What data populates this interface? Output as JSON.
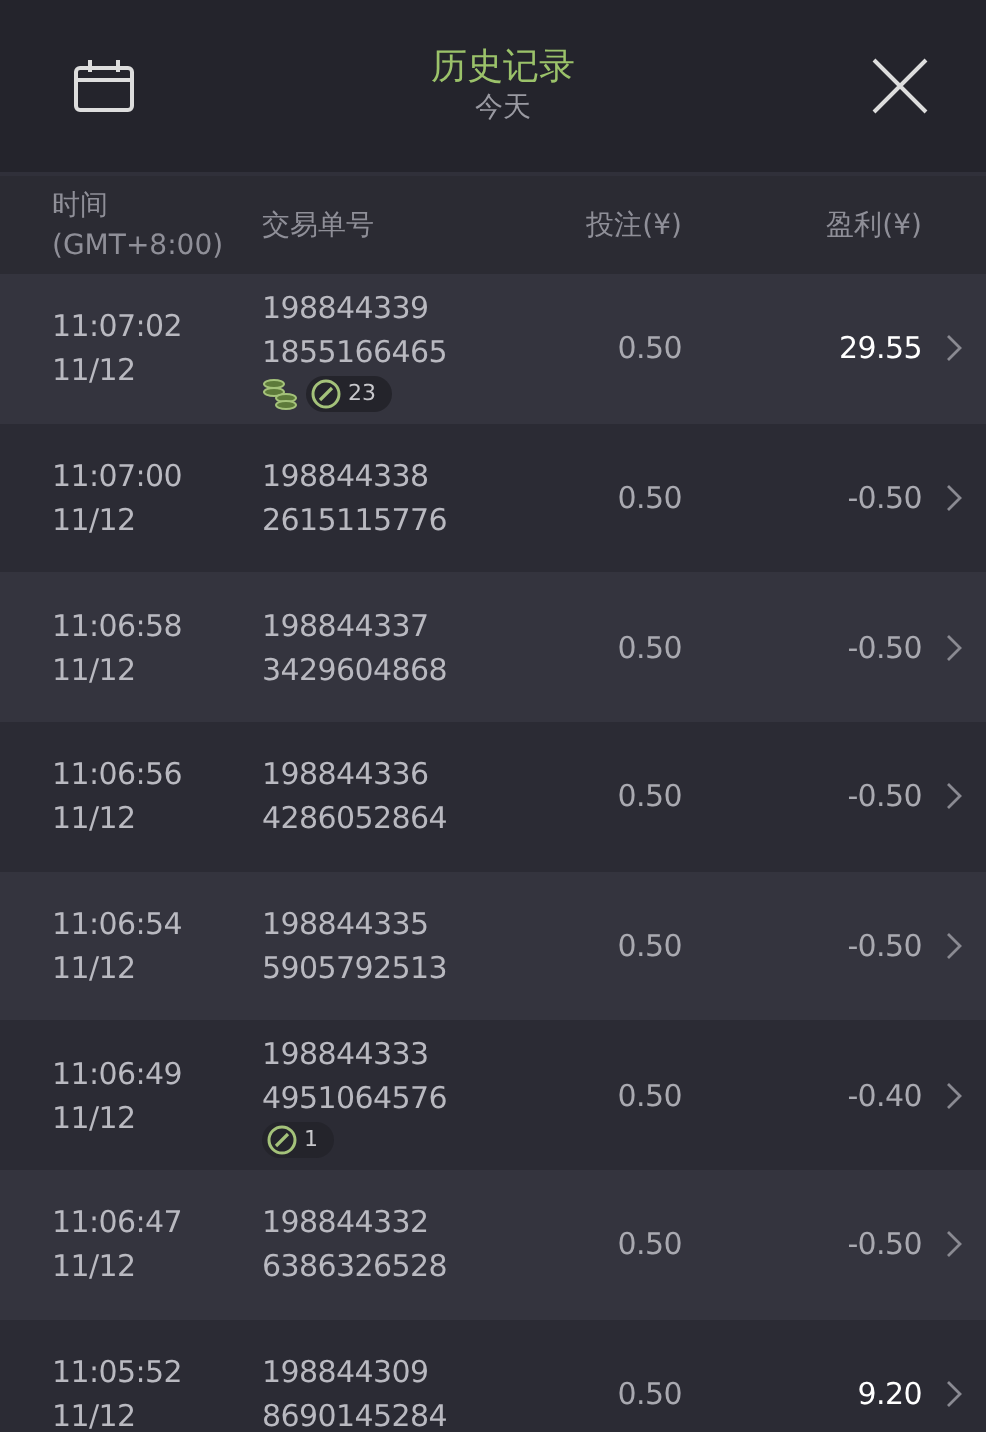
{
  "header": {
    "title": "历史记录",
    "subtitle": "今天"
  },
  "columns": [
    {
      "label": "时间",
      "sublabel": "(GMT+8:00)"
    },
    {
      "label": "交易单号"
    },
    {
      "label": "投注(¥)"
    },
    {
      "label": "盈利(¥)"
    }
  ],
  "rows": [
    {
      "time": "11:07:02",
      "date": "11/12",
      "id": "198844339",
      "ref": "1855166465",
      "coins": true,
      "badge": "23",
      "bet": "0.50",
      "profit": "29.55",
      "won": true
    },
    {
      "time": "11:07:00",
      "date": "11/12",
      "id": "198844338",
      "ref": "2615115776",
      "coins": false,
      "bet": "0.50",
      "profit": "-0.50",
      "won": false
    },
    {
      "time": "11:06:58",
      "date": "11/12",
      "id": "198844337",
      "ref": "3429604868",
      "coins": false,
      "bet": "0.50",
      "profit": "-0.50",
      "won": false
    },
    {
      "time": "11:06:56",
      "date": "11/12",
      "id": "198844336",
      "ref": "4286052864",
      "coins": false,
      "bet": "0.50",
      "profit": "-0.50",
      "won": false
    },
    {
      "time": "11:06:54",
      "date": "11/12",
      "id": "198844335",
      "ref": "5905792513",
      "coins": false,
      "bet": "0.50",
      "profit": "-0.50",
      "won": false
    },
    {
      "time": "11:06:49",
      "date": "11/12",
      "id": "198844333",
      "ref": "4951064576",
      "coins": false,
      "badge": "1",
      "bet": "0.50",
      "profit": "-0.40",
      "won": false
    },
    {
      "time": "11:06:47",
      "date": "11/12",
      "id": "198844332",
      "ref": "6386326528",
      "coins": false,
      "bet": "0.50",
      "profit": "-0.50",
      "won": false
    },
    {
      "time": "11:05:52",
      "date": "11/12",
      "id": "198844309",
      "ref": "8690145284",
      "coins": false,
      "bet": "0.50",
      "profit": "9.20",
      "won": true
    }
  ]
}
